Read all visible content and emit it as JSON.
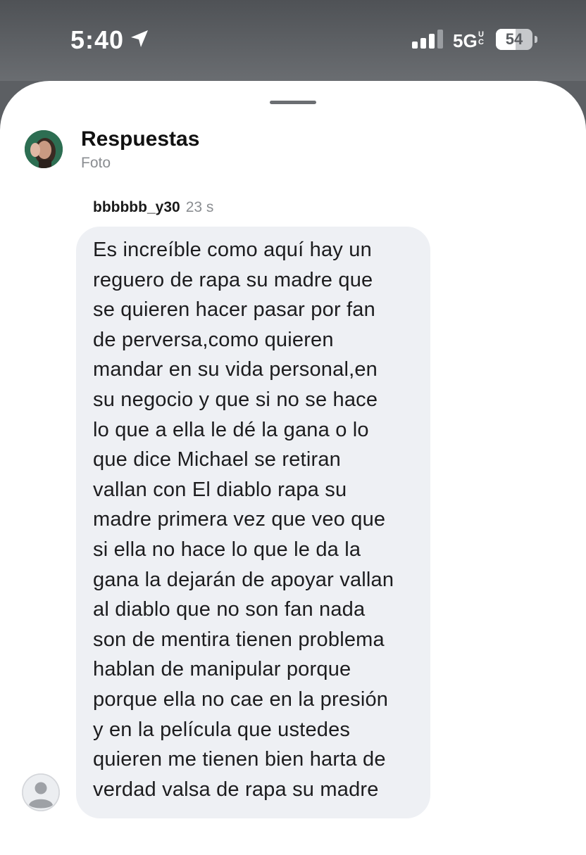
{
  "status_bar": {
    "time": "5:40",
    "network": "5G",
    "network_suffix": "UC",
    "battery": "54",
    "battery_level": 0.54
  },
  "header": {
    "title": "Respuestas",
    "subtitle": "Foto"
  },
  "reply": {
    "username": "bbbbbb_y30",
    "time": "23 s",
    "message": "Es increíble como aquí hay un\nreguero de rapa su madre que\nse quieren hacer pasar por fan\nde perversa,como quieren\nmandar en su vida personal,en\nsu negocio y que si no se hace\nlo que a ella le dé la gana o lo\nque dice Michael se retiran\nvallan con El diablo rapa su\nmadre primera vez que veo que\nsi ella no hace lo que le da la\ngana la dejarán de apoyar vallan\nal diablo que no son fan nada\nson de mentira tienen problema\nhablan de manipular porque\nporque ella no cae en la presión\ny en la película que ustedes\nquieren me tienen bien harta de\nverdad valsa de rapa su madre"
  },
  "icons": {
    "location": "location-arrow-icon",
    "signal": "cellular-signal-icon",
    "battery": "battery-icon",
    "sender_avatar": "default-person-icon"
  },
  "colors": {
    "status_bar_bg": "#5c5f63",
    "bubble_bg": "#eef0f4",
    "muted_text": "#8a8d91"
  }
}
